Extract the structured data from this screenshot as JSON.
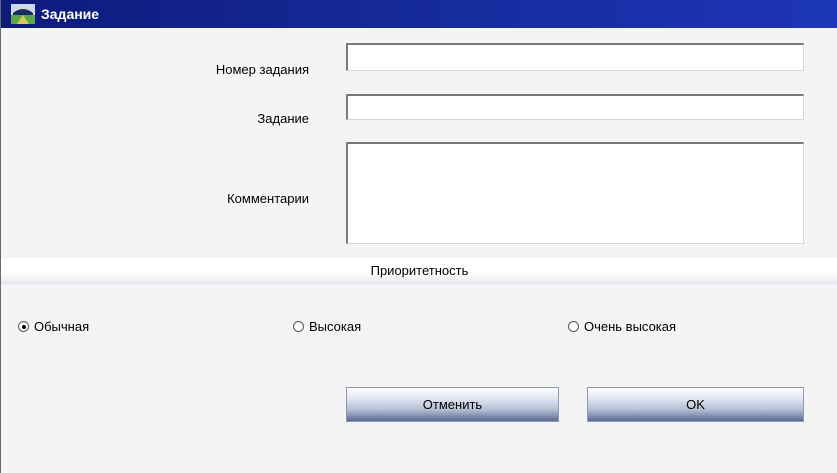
{
  "window": {
    "title": "Задание",
    "title_icon": "app-icon"
  },
  "form": {
    "task_number": {
      "label": "Номер задания",
      "value": ""
    },
    "task": {
      "label": "Задание",
      "value": ""
    },
    "comments": {
      "label": "Комментарии",
      "value": ""
    }
  },
  "priority": {
    "heading": "Приоритетность",
    "options": [
      {
        "label": "Обычная",
        "checked": true
      },
      {
        "label": "Высокая",
        "checked": false
      },
      {
        "label": "Очень высокая",
        "checked": false
      }
    ]
  },
  "buttons": {
    "cancel": "Отменить",
    "ok": "OK"
  },
  "colors": {
    "titlebar": "#142894",
    "background": "#f4f4f4"
  }
}
